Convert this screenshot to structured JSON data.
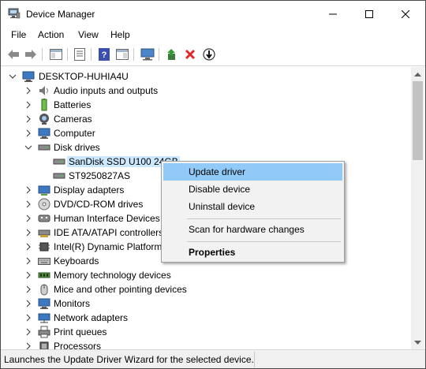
{
  "window": {
    "title": "Device Manager"
  },
  "menu": {
    "file": "File",
    "action": "Action",
    "view": "View",
    "help": "Help"
  },
  "toolbar": [
    "back-arrow-icon",
    "forward-arrow-icon",
    "show-hide-console-tree-icon",
    "properties-icon",
    "help-icon",
    "action-pane-icon",
    "monitor-icon",
    "update-driver-icon",
    "uninstall-device-icon",
    "scan-hardware-icon"
  ],
  "tree": {
    "root": "DESKTOP-HUHIA4U",
    "items": [
      {
        "label": "Audio inputs and outputs",
        "icon": "speaker-icon"
      },
      {
        "label": "Batteries",
        "icon": "battery-icon"
      },
      {
        "label": "Cameras",
        "icon": "camera-icon"
      },
      {
        "label": "Computer",
        "icon": "computer-icon"
      },
      {
        "label": "Disk drives",
        "icon": "disk-drive-icon",
        "expanded": true
      },
      {
        "label": "SanDisk SSD U100 24GB",
        "icon": "drive-icon",
        "child": true,
        "selected": true
      },
      {
        "label": "ST9250827AS",
        "icon": "drive-icon",
        "child": true
      },
      {
        "label": "Display adapters",
        "icon": "display-adapter-icon"
      },
      {
        "label": "DVD/CD-ROM drives",
        "icon": "dvd-icon"
      },
      {
        "label": "Human Interface Devices",
        "icon": "hid-icon"
      },
      {
        "label": "IDE ATA/ATAPI controllers",
        "icon": "ide-controller-icon"
      },
      {
        "label": "Intel(R) Dynamic Platform",
        "icon": "chip-icon"
      },
      {
        "label": "Keyboards",
        "icon": "keyboard-icon"
      },
      {
        "label": "Memory technology devices",
        "icon": "memory-icon"
      },
      {
        "label": "Mice and other pointing devices",
        "icon": "mouse-icon"
      },
      {
        "label": "Monitors",
        "icon": "monitor-icon"
      },
      {
        "label": "Network adapters",
        "icon": "network-icon"
      },
      {
        "label": "Print queues",
        "icon": "printer-icon"
      },
      {
        "label": "Processors",
        "icon": "processor-icon"
      }
    ]
  },
  "context_menu": {
    "update_driver": "Update driver",
    "disable_device": "Disable device",
    "uninstall_device": "Uninstall device",
    "scan_hardware": "Scan for hardware changes",
    "properties": "Properties"
  },
  "status": {
    "text": "Launches the Update Driver Wizard for the selected device."
  },
  "colors": {
    "selection": "#cce8ff",
    "menu_hover": "#91c9f7",
    "menu_bg": "#f2f2f2",
    "uninstall_red": "#e0282a"
  }
}
